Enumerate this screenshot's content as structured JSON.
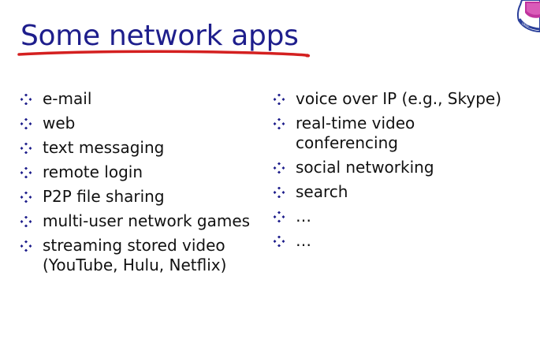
{
  "slide": {
    "title": "Some network apps",
    "left_items": [
      {
        "lines": [
          "e-mail"
        ]
      },
      {
        "lines": [
          "web"
        ]
      },
      {
        "lines": [
          "text messaging"
        ]
      },
      {
        "lines": [
          "remote login"
        ]
      },
      {
        "lines": [
          "P2P file sharing"
        ]
      },
      {
        "lines": [
          "multi-user network games"
        ]
      },
      {
        "lines": [
          "streaming stored video",
          "(YouTube, Hulu, Netflix)"
        ]
      }
    ],
    "right_items": [
      {
        "lines": [
          "voice over IP (e.g., Skype)"
        ]
      },
      {
        "lines": [
          "real-time video",
          "conferencing"
        ]
      },
      {
        "lines": [
          "social networking"
        ]
      },
      {
        "lines": [
          "search"
        ]
      },
      {
        "lines": [
          "…"
        ]
      },
      {
        "lines": [
          "…"
        ]
      }
    ]
  },
  "colors": {
    "title": "#1e1e8c",
    "underline": "#d42020",
    "bullet": "#1e1e8c",
    "text": "#111111"
  },
  "icons": {
    "bullet": "four-diamond-bullet-icon",
    "logo": "university-seal-logo-icon"
  }
}
